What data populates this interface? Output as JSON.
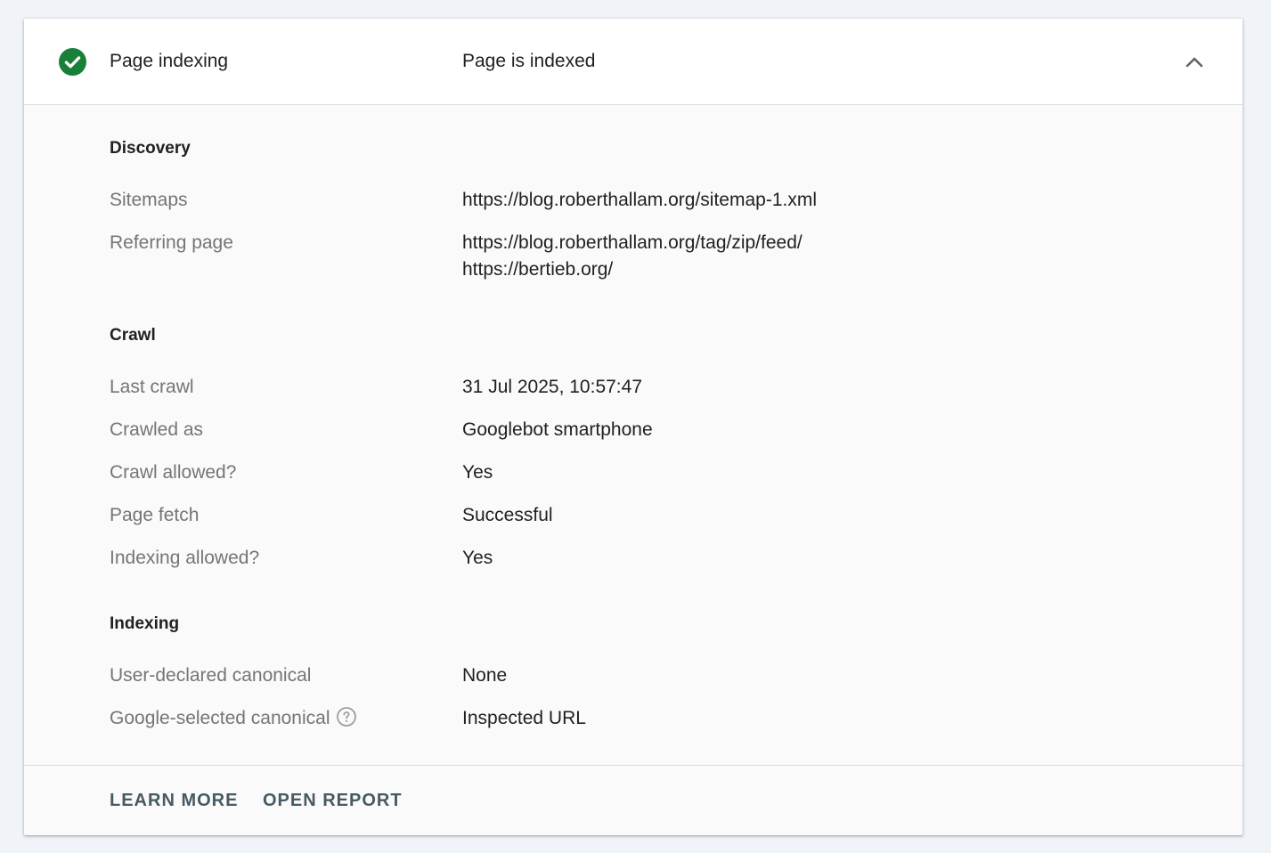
{
  "header": {
    "title": "Page indexing",
    "status": "Page is indexed",
    "status_icon": "check-circle-icon",
    "collapse_icon": "chevron-up-icon",
    "status_color": "#188038"
  },
  "discovery": {
    "title": "Discovery",
    "sitemaps_label": "Sitemaps",
    "sitemaps_value": "https://blog.roberthallam.org/sitemap-1.xml",
    "referring_label": "Referring page",
    "referring_values": [
      "https://blog.roberthallam.org/tag/zip/feed/",
      "https://bertieb.org/"
    ]
  },
  "crawl": {
    "title": "Crawl",
    "rows": [
      {
        "label": "Last crawl",
        "value": "31 Jul 2025, 10:57:47"
      },
      {
        "label": "Crawled as",
        "value": "Googlebot smartphone"
      },
      {
        "label": "Crawl allowed?",
        "value": "Yes"
      },
      {
        "label": "Page fetch",
        "value": "Successful"
      },
      {
        "label": "Indexing allowed?",
        "value": "Yes"
      }
    ]
  },
  "indexing": {
    "title": "Indexing",
    "user_canonical_label": "User-declared canonical",
    "user_canonical_value": "None",
    "google_canonical_label": "Google-selected canonical",
    "google_canonical_value": "Inspected URL",
    "help_icon": "help-circle-icon"
  },
  "footer": {
    "learn_more": "LEARN MORE",
    "open_report": "OPEN REPORT",
    "button_color": "#455a64"
  }
}
